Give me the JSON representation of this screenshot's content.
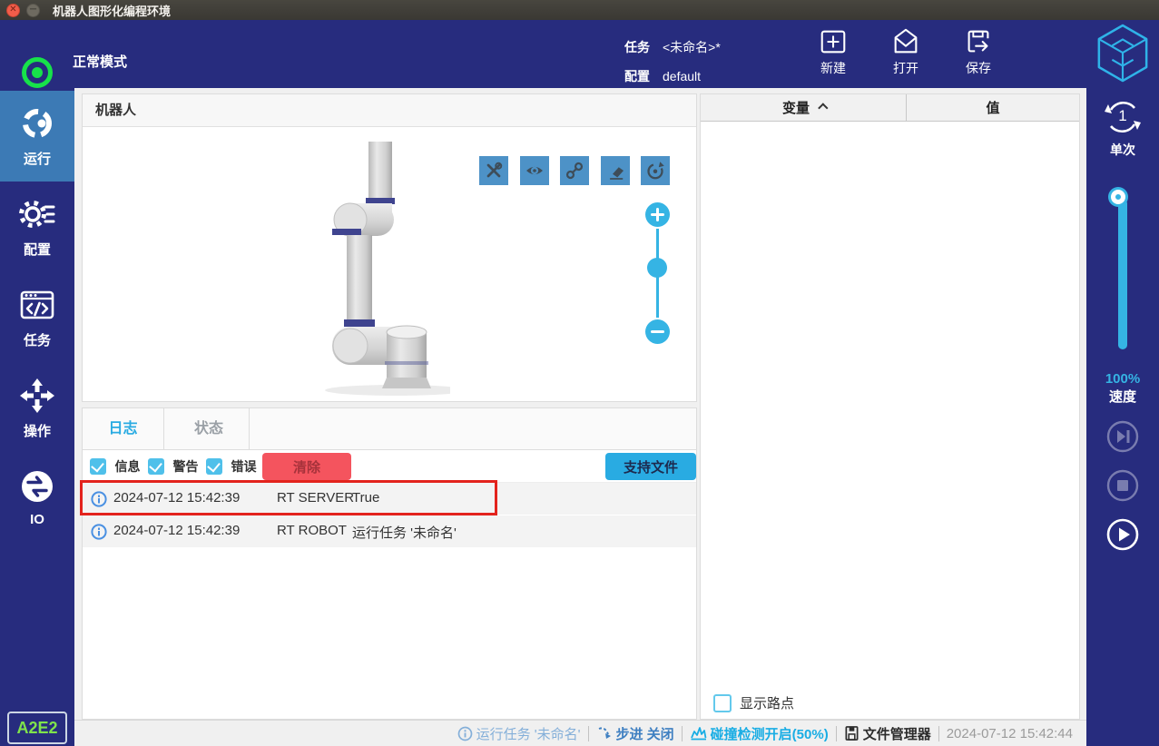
{
  "window": {
    "title": "机器人图形化编程环境"
  },
  "header": {
    "mode_label": "正常模式",
    "task_label": "任务",
    "task_value": "<未命名>*",
    "config_label": "配置",
    "config_value": "default",
    "new_label": "新建",
    "open_label": "打开",
    "save_label": "保存"
  },
  "sidebar": {
    "items": [
      {
        "label": "运行"
      },
      {
        "label": "配置"
      },
      {
        "label": "任务"
      },
      {
        "label": "操作"
      },
      {
        "label": "IO"
      }
    ],
    "badge": "A2E2"
  },
  "robot_panel": {
    "title": "机器人"
  },
  "log_panel": {
    "tabs": [
      {
        "label": "日志"
      },
      {
        "label": "状态"
      }
    ],
    "filters": [
      {
        "label": "信息"
      },
      {
        "label": "警告"
      },
      {
        "label": "错误"
      }
    ],
    "clear_label": "清除",
    "support_label": "支持文件",
    "entries": [
      {
        "time": "2024-07-12 15:42:39",
        "source": "RT SERVER",
        "message": "True"
      },
      {
        "time": "2024-07-12 15:42:39",
        "source": "RT ROBOT",
        "message": "运行任务 '未命名'"
      }
    ]
  },
  "variables_panel": {
    "col_variable": "变量",
    "col_value": "值",
    "show_waypoints": "显示路点"
  },
  "run_controls": {
    "single_count": "1",
    "single_label": "单次",
    "speed_value": "100%",
    "speed_label": "速度"
  },
  "status_bar": {
    "running_task": "运行任务 '未命名'",
    "step": "步进 关闭",
    "collision": "碰撞检测开启(50%)",
    "file_manager": "文件管理器",
    "timestamp": "2024-07-12 15:42:44"
  },
  "colors": {
    "navy": "#272c7e",
    "accent_blue": "#29abe2",
    "active_nav": "#3c7ab5",
    "tool_button": "#4d92c7",
    "clear_red": "#f4545e",
    "annotation_red": "#e3231d",
    "mode_green": "#17e14a",
    "badge_green": "#7fe34b",
    "slider_blue": "#35b4e4"
  }
}
